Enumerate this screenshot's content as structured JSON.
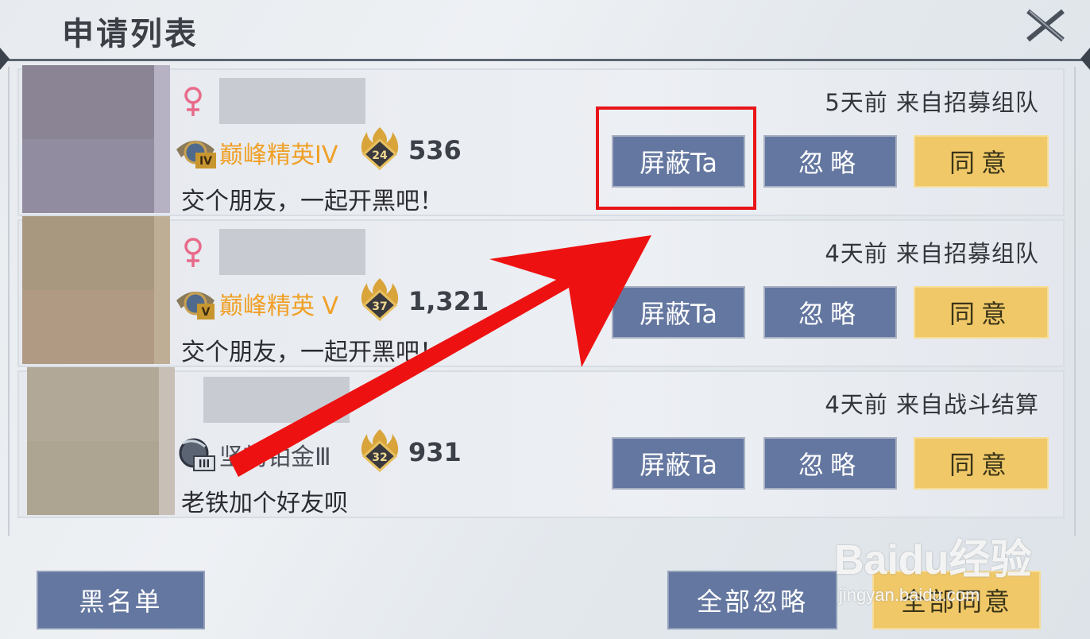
{
  "panel": {
    "title": "申请列表",
    "close_icon": "close-icon"
  },
  "requests": [
    {
      "time_source": "5天前 来自招募组队",
      "gender_icon": "female-icon",
      "rank_name": "巅峰精英IV",
      "rank_roman": "IV",
      "level": "24",
      "score": "536",
      "message": "交个朋友，一起开黑吧！",
      "avatar_colors": [
        "#8a8494",
        "#918ca0"
      ],
      "avatar_strip": "#b6b2c4"
    },
    {
      "time_source": "4天前 来自招募组队",
      "gender_icon": "female-icon",
      "rank_name": "巅峰精英 V",
      "rank_roman": "V",
      "level": "37",
      "score": "1,321",
      "message": "交个朋友，一起开黑吧！",
      "avatar_colors": [
        "#a99880",
        "#b09a84"
      ],
      "avatar_strip": "#bfae96"
    },
    {
      "time_source": "4天前 来自战斗结算",
      "gender_icon": "",
      "rank_name": "坚韧铂金Ⅲ",
      "rank_roman": "III",
      "level": "32",
      "score": "931",
      "message": "老铁加个好友呗",
      "avatar_colors": [
        "#b2a898",
        "#aea492"
      ],
      "avatar_strip": "#c8bfb6"
    }
  ],
  "buttons": {
    "block": "屏蔽Ta",
    "ignore": "忽略",
    "agree": "同意"
  },
  "footer": {
    "blacklist": "黑名单",
    "ignore_all": "全部忽略",
    "agree_all": "全部同意"
  },
  "watermark": {
    "logo": "Baidu经验",
    "url": "jingyan.baidu.com"
  },
  "annotation": {
    "highlight_color": "#e8141a",
    "arrow_color": "#ee1111"
  },
  "colors": {
    "button_blue": "#6477a0",
    "button_gold": "#f0c868",
    "rank_gold": "#f0a027"
  }
}
